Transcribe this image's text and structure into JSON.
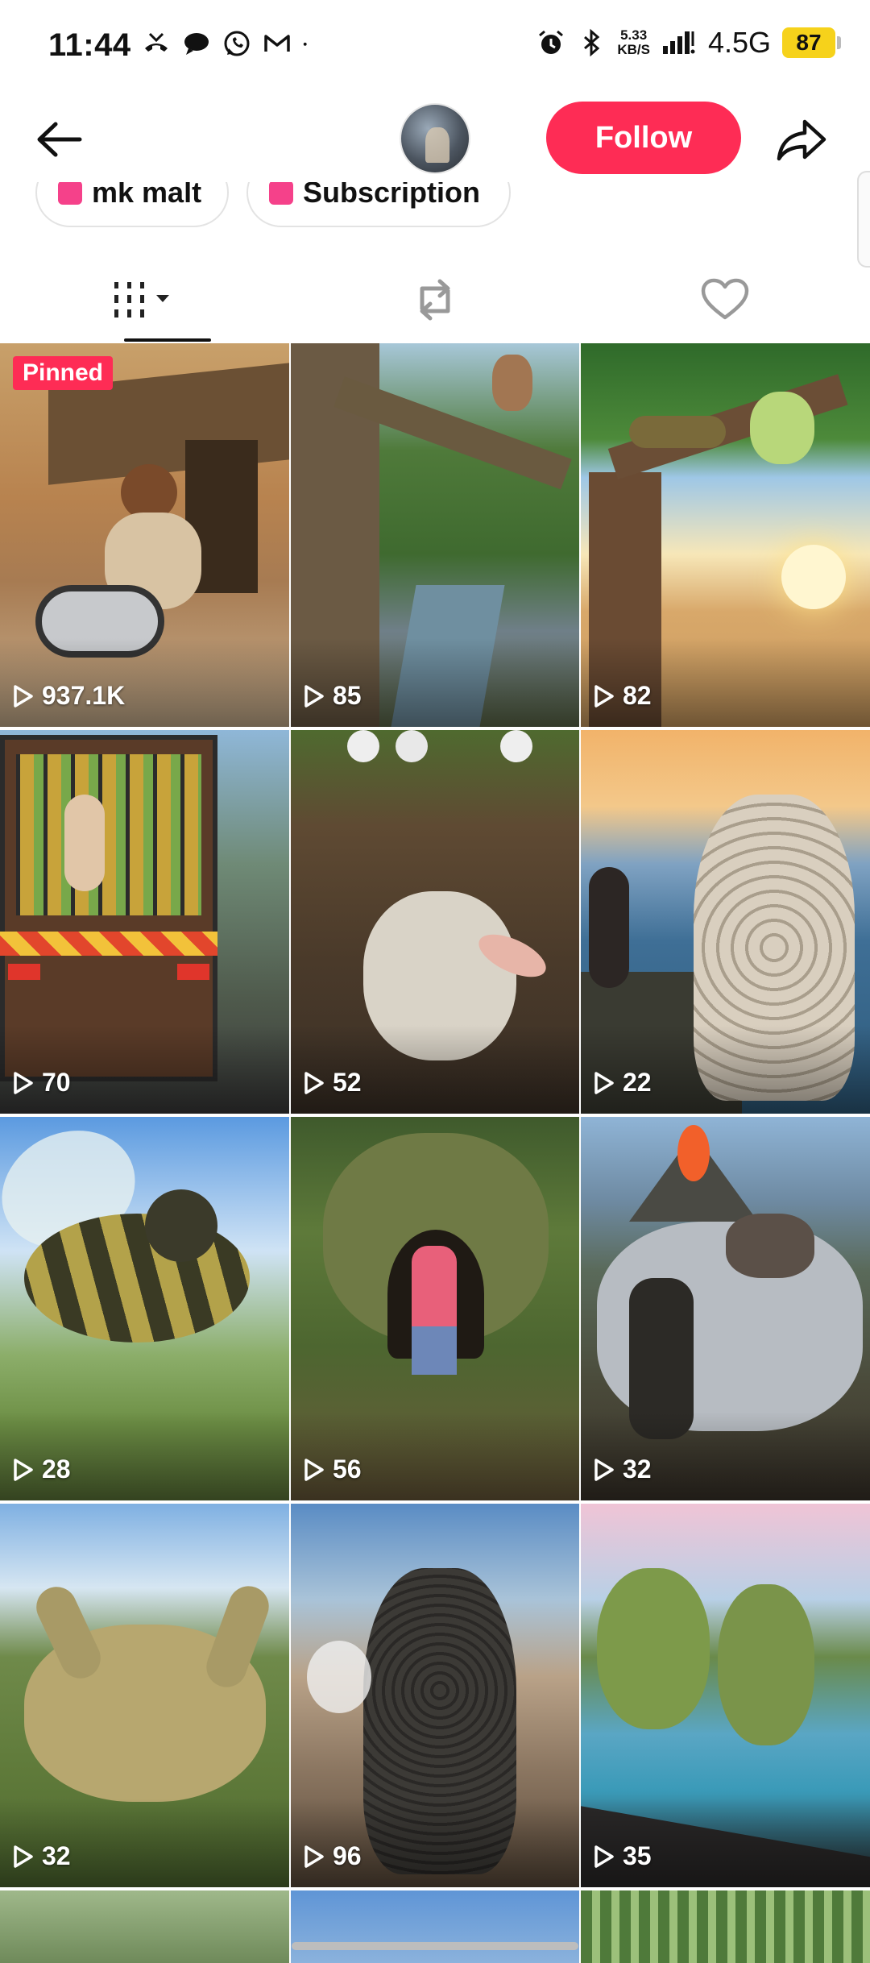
{
  "status_bar": {
    "time": "11:44",
    "net_speed_value": "5.33",
    "net_speed_unit": "KB/S",
    "network": "4.5G",
    "battery": "87",
    "icons": [
      "missed-call-icon",
      "chat-icon",
      "whatsapp-icon",
      "gmail-icon",
      "dot-icon",
      "alarm-icon",
      "bluetooth-icon",
      "signal-icon"
    ]
  },
  "header": {
    "follow_label": "Follow",
    "icons": [
      "back-arrow-icon",
      "avatar",
      "share-icon"
    ]
  },
  "chips": [
    {
      "label": "mk malt"
    },
    {
      "label": "Subscription"
    }
  ],
  "tabs": [
    {
      "name": "videos",
      "icon": "grid-icon",
      "active": true
    },
    {
      "name": "reposts",
      "icon": "repost-icon",
      "active": false
    },
    {
      "name": "liked",
      "icon": "heart-icon",
      "active": false
    }
  ],
  "pinned_label": "Pinned",
  "videos": [
    {
      "views": "937.1K",
      "pinned": true
    },
    {
      "views": "85"
    },
    {
      "views": "82"
    },
    {
      "views": "70"
    },
    {
      "views": "52"
    },
    {
      "views": "22"
    },
    {
      "views": "28"
    },
    {
      "views": "56"
    },
    {
      "views": "32"
    },
    {
      "views": "32"
    },
    {
      "views": "96"
    },
    {
      "views": "35"
    }
  ],
  "colors": {
    "accent": "#fe2c55",
    "battery": "#f6d21b"
  }
}
